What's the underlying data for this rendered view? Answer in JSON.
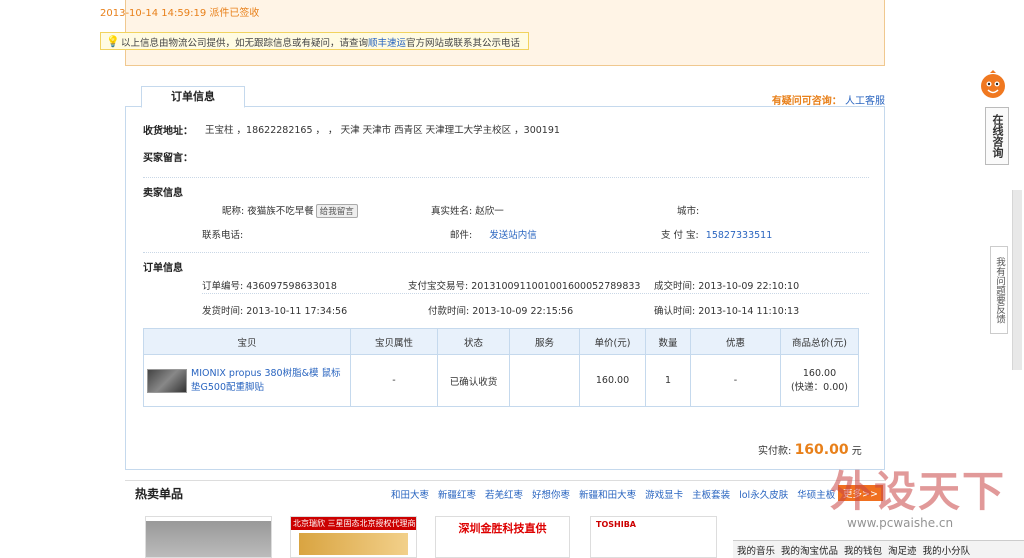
{
  "logistics": {
    "latest": "2013-10-14 14:59:19 派件已签收",
    "tip_pre": "以上信息由物流公司提供，如无跟踪信息或有疑问，请查询",
    "tip_link": "顺丰速运",
    "tip_post": "官方网站或联系其公示电话"
  },
  "order_tab": "订单信息",
  "help": {
    "q": "有疑问可咨询：",
    "link": "人工客服"
  },
  "address": {
    "label": "收货地址：",
    "value": "王宝柱 ，18622282165 ， ， 天津 天津市 西青区 天津理工大学主校区 ，300191"
  },
  "buyer_msg_label": "买家留言：",
  "seller": {
    "title": "卖家信息",
    "nick_label": "昵称:",
    "nick": "夜猫族不吃早餐",
    "msg_btn": "给我留言",
    "realname_label": "真实姓名:",
    "realname": "赵欣一",
    "city_label": "城市:",
    "phone_label": "联系电话:",
    "mail_label": "邮件:",
    "mail": "发送站内信",
    "alipay_label": "支 付 宝:",
    "alipay": "15827333511"
  },
  "order": {
    "title": "订单信息",
    "no_label": "订单编号:",
    "no": "436097598633018",
    "trade_label": "支付宝交易号:",
    "trade": "2013100911001001600052789833",
    "deal_label": "成交时间:",
    "deal": "2013-10-09 22:10:10",
    "ship_label": "发货时间:",
    "ship": "2013-10-11 17:34:56",
    "pay_label": "付款时间:",
    "pay": "2013-10-09 22:15:56",
    "confirm_label": "确认时间:",
    "confirm": "2013-10-14 11:10:13"
  },
  "table": {
    "headers": [
      "宝贝",
      "宝贝属性",
      "状态",
      "服务",
      "单价(元)",
      "数量",
      "优惠",
      "商品总价(元)"
    ],
    "row": {
      "name": "MIONIX propus 380树脂&模 鼠标垫G500配重脚贴",
      "attr": "-",
      "status": "已确认收货",
      "service": "",
      "price": "160.00",
      "qty": "1",
      "discount": "-",
      "total": "160.00",
      "shipping": "(快递：0.00)"
    }
  },
  "paid": {
    "label": "实付款:",
    "amount": "160.00",
    "unit": "元"
  },
  "hot": {
    "title": "热卖单品",
    "links": [
      "和田大枣",
      "新疆红枣",
      "若羌红枣",
      "好想你枣",
      "新疆和田大枣",
      "游戏显卡",
      "主板套装",
      "lol永久皮肤",
      "华硕主板"
    ],
    "more": "更多>>",
    "ads": [
      "北京瑞欣 三星固态北京授权代理商",
      "深圳金胜科技直供",
      "TOSHIBA"
    ]
  },
  "side": {
    "consult": "在线咨询",
    "feedback": "我有问题要反馈"
  },
  "watermark": {
    "big": "外设天下",
    "url": "www.pcwaishe.cn"
  },
  "toolbar": [
    "我的音乐",
    "我的淘宝优品",
    "我的钱包",
    "淘足迹",
    "我的小分队"
  ]
}
